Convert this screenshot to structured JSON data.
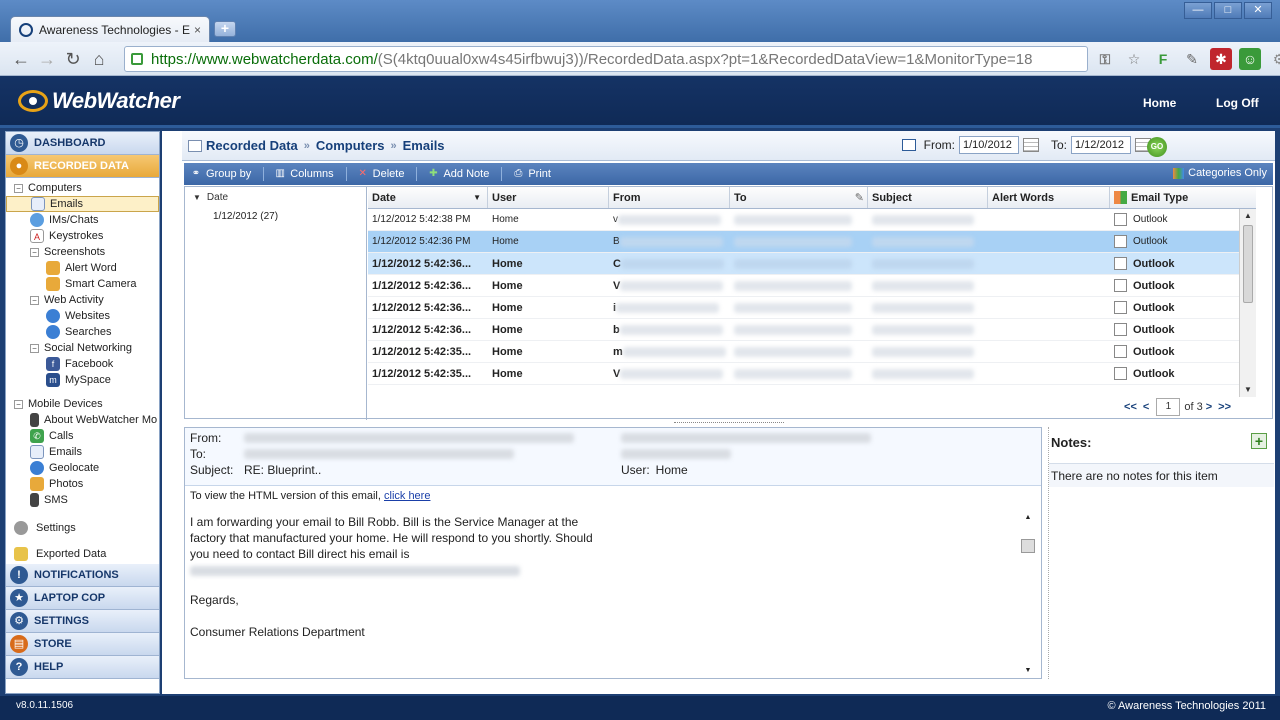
{
  "browser": {
    "tab_title": "Awareness Technologies - E",
    "tab_close": "×",
    "new_tab": "+",
    "url_scheme_host": "https://www.webwatcherdata.com/",
    "url_path": "(S(4ktq0uual0xw4s45irfbwuj3))/RecordedData.aspx?pt=1&RecordedDataView=1&MonitorType=18",
    "win_min": "—",
    "win_max": "□",
    "win_close": "✕"
  },
  "header": {
    "logo_text": "WebWatcher",
    "home_label": "Home",
    "logoff_label": "Log Off"
  },
  "sidebar": {
    "dashboard": "DASHBOARD",
    "recorded_data": "RECORDED DATA",
    "computers": "Computers",
    "emails": "Emails",
    "ims": "IMs/Chats",
    "keystrokes": "Keystrokes",
    "screenshots": "Screenshots",
    "alert_word": "Alert Word",
    "smart_camera": "Smart Camera",
    "web_activity": "Web Activity",
    "websites": "Websites",
    "searches": "Searches",
    "social_networking": "Social Networking",
    "facebook": "Facebook",
    "myspace": "MySpace",
    "mobile_devices": "Mobile Devices",
    "about_webwatcher": "About WebWatcher Mo",
    "calls": "Calls",
    "mobile_emails": "Emails",
    "geolocate": "Geolocate",
    "photos": "Photos",
    "sms": "SMS",
    "settings_item": "Settings",
    "exported_data": "Exported Data",
    "notifications": "NOTIFICATIONS",
    "laptop_cop": "LAPTOP COP",
    "settings": "SETTINGS",
    "store": "STORE",
    "help": "HELP"
  },
  "breadcrumb": {
    "recorded_data": "Recorded Data",
    "computers": "Computers",
    "emails": "Emails",
    "sep": "»"
  },
  "date_filter": {
    "from_label": "From:",
    "from_value": "1/10/2012",
    "to_label": "To:",
    "to_value": "1/12/2012",
    "go_label": "GO"
  },
  "grid_toolbar": {
    "group_by": "Group by",
    "columns": "Columns",
    "delete": "Delete",
    "add_note": "Add Note",
    "print": "Print",
    "categories_only": "Categories Only"
  },
  "group_pane": {
    "header": "Date",
    "group": "1/12/2012 (27)"
  },
  "columns": [
    "Date",
    "User",
    "From",
    "To",
    "Subject",
    "Alert Words",
    "Email Type"
  ],
  "rows": [
    {
      "date": "1/12/2012 5:42:38 PM",
      "user": "Home",
      "from_initial": "v",
      "type": "Outlook",
      "bold": false
    },
    {
      "date": "1/12/2012 5:42:36 PM",
      "user": "Home",
      "from_initial": "B",
      "type": "Outlook",
      "bold": false
    },
    {
      "date": "1/12/2012 5:42:36...",
      "user": "Home",
      "from_initial": "C",
      "type": "Outlook",
      "bold": true
    },
    {
      "date": "1/12/2012 5:42:36...",
      "user": "Home",
      "from_initial": "V",
      "type": "Outlook",
      "bold": true
    },
    {
      "date": "1/12/2012 5:42:36...",
      "user": "Home",
      "from_initial": "i",
      "type": "Outlook",
      "bold": true
    },
    {
      "date": "1/12/2012 5:42:36...",
      "user": "Home",
      "from_initial": "b",
      "type": "Outlook",
      "bold": true
    },
    {
      "date": "1/12/2012 5:42:35...",
      "user": "Home",
      "from_initial": "m",
      "type": "Outlook",
      "bold": true
    },
    {
      "date": "1/12/2012 5:42:35...",
      "user": "Home",
      "from_initial": "V",
      "type": "Outlook",
      "bold": true
    }
  ],
  "pager": {
    "first": "<<",
    "prev": "<",
    "page": "1",
    "of": "of 3",
    "next": ">",
    "last": ">>"
  },
  "preview": {
    "from_label": "From:",
    "to_label": "To:",
    "subject_label": "Subject:",
    "subject_value": "RE: Blueprint..",
    "user_label": "User:",
    "user_value": "Home",
    "html_hint": "To view the HTML version of this email,",
    "html_link": "click here",
    "body_p1": "I am forwarding your email to Bill Robb. Bill is the Service Manager at the factory that manufactured your home. He will respond to you shortly. Should you need to contact Bill direct his email is",
    "body_regards": "Regards,",
    "body_dept": "Consumer Relations Department"
  },
  "notes": {
    "title": "Notes:",
    "empty": "There are no notes for this item"
  },
  "footer": {
    "version": "v8.0.11.1506",
    "copyright": "© Awareness Technologies 2011"
  }
}
